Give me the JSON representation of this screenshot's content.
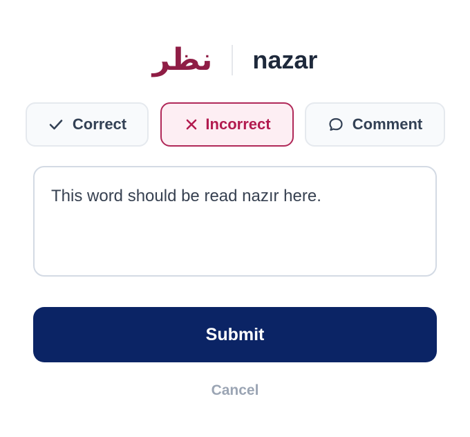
{
  "word": {
    "arabic": "نظر",
    "transliteration": "nazar"
  },
  "options": {
    "correct": {
      "label": "Correct",
      "icon": "check-icon"
    },
    "incorrect": {
      "label": "Incorrect",
      "icon": "x-icon",
      "selected": true
    },
    "comment": {
      "label": "Comment",
      "icon": "speech-bubble-icon"
    }
  },
  "comment_box": {
    "value": "This word should be read nazır here."
  },
  "actions": {
    "submit_label": "Submit",
    "cancel_label": "Cancel"
  },
  "colors": {
    "accent_arabic": "#8f1d45",
    "incorrect_selected": "#b21b4f",
    "incorrect_bg": "#fdeef3",
    "submit_bg": "#0b2465",
    "cancel_text": "#9ba5b4"
  }
}
